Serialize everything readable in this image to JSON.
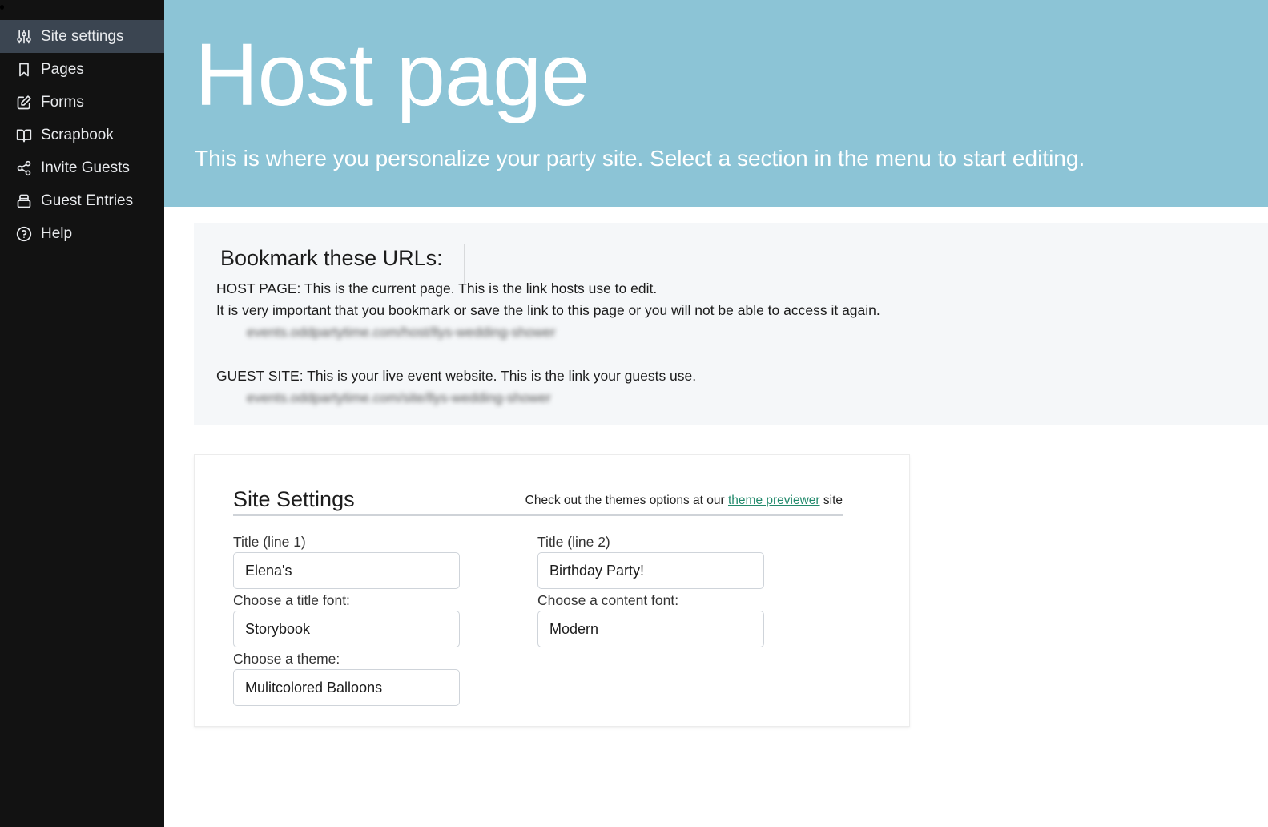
{
  "sidebar": {
    "items": [
      {
        "label": "Site settings",
        "icon": "sliders-icon",
        "active": true
      },
      {
        "label": "Pages",
        "icon": "bookmark-icon",
        "active": false
      },
      {
        "label": "Forms",
        "icon": "edit-icon",
        "active": false
      },
      {
        "label": "Scrapbook",
        "icon": "book-open-icon",
        "active": false
      },
      {
        "label": "Invite Guests",
        "icon": "share-icon",
        "active": false
      },
      {
        "label": "Guest Entries",
        "icon": "inbox-icon",
        "active": false
      },
      {
        "label": "Help",
        "icon": "help-circle-icon",
        "active": false
      }
    ]
  },
  "header": {
    "title": "Host page",
    "subtitle": "This is where you personalize your party site. Select a section in the menu to start editing."
  },
  "bookmark": {
    "heading": "Bookmark these URLs:",
    "host_line": "HOST PAGE: This is the current page. This is the link hosts use to edit.",
    "host_warning": "It is very important that you bookmark or save the link to this page or you will not be able to access it again.",
    "host_url": "events.oddpartytime.com/host/llys-wedding-shower",
    "guest_line": "GUEST SITE: This is your live event website. This is the link your guests use.",
    "guest_url": "events.oddpartytime.com/site/llys-wedding-shower"
  },
  "settings": {
    "heading": "Site Settings",
    "note_prefix": "Check out the themes options at our ",
    "note_link": "theme previewer",
    "note_suffix": " site",
    "fields": {
      "title1": {
        "label": "Title (line 1)",
        "value": "Elena's"
      },
      "title2": {
        "label": "Title (line 2)",
        "value": "Birthday Party!"
      },
      "title_font": {
        "label": "Choose a title font:",
        "value": "Storybook"
      },
      "content_font": {
        "label": "Choose a content font:",
        "value": "Modern"
      },
      "theme": {
        "label": "Choose a theme:",
        "value": "Mulitcolored Balloons"
      }
    }
  },
  "colors": {
    "sidebar_bg": "#121212",
    "sidebar_active": "#3b4551",
    "header_bg": "#8cc4d6",
    "bookmark_bg": "#f5f7f9",
    "link": "#238a6c"
  }
}
